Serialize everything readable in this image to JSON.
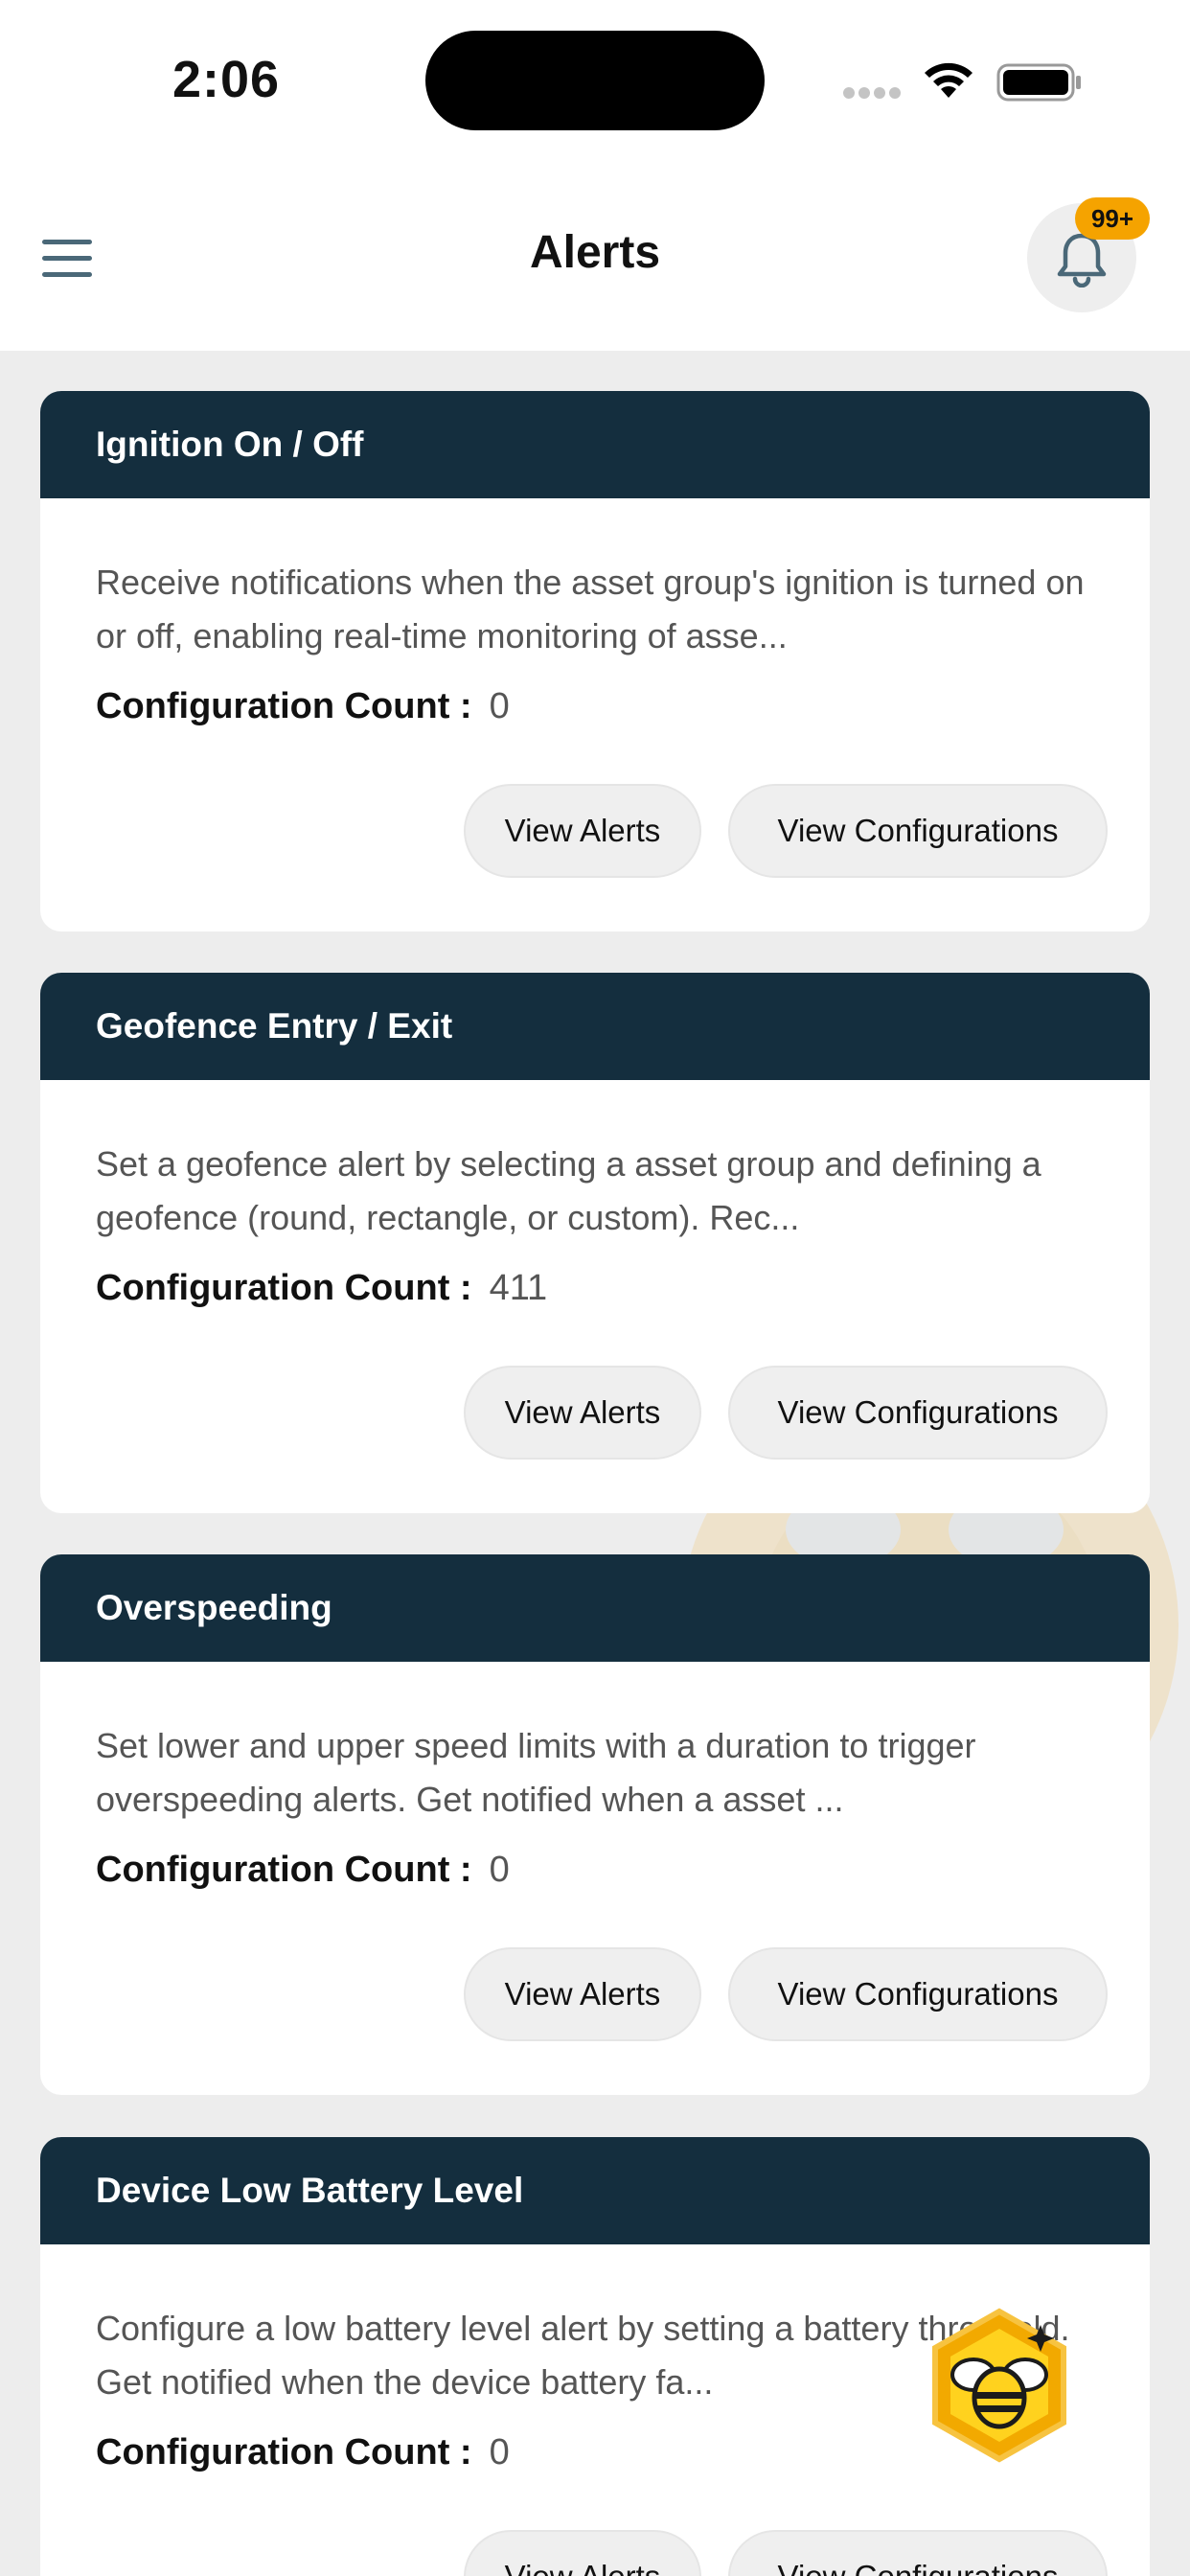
{
  "status_bar": {
    "time": "2:06"
  },
  "header": {
    "title": "Alerts",
    "notification_badge": "99+"
  },
  "cards": [
    {
      "title": "Ignition On / Off",
      "description": "Receive notifications when the asset group's ignition is turned on or off, enabling real-time monitoring of asse...",
      "count_label": "Configuration Count :",
      "count_value": "0",
      "view_alerts": "View Alerts",
      "view_configurations": "View Configurations"
    },
    {
      "title": "Geofence Entry / Exit",
      "description": "Set a geofence alert by selecting a asset group and defining a geofence (round, rectangle, or custom). Rec...",
      "count_label": "Configuration Count :",
      "count_value": "411",
      "view_alerts": "View Alerts",
      "view_configurations": "View Configurations"
    },
    {
      "title": "Overspeeding",
      "description": "Set lower and upper speed limits with a duration to trigger overspeeding alerts. Get notified when a asset ...",
      "count_label": "Configuration Count :",
      "count_value": "0",
      "view_alerts": "View Alerts",
      "view_configurations": "View Configurations"
    },
    {
      "title": "Device Low Battery Level",
      "description": "Configure a low battery level alert by setting a battery threshold. Get notified when the device battery fa...",
      "count_label": "Configuration Count :",
      "count_value": "0",
      "view_alerts": "View Alerts",
      "view_configurations": "View Configurations"
    }
  ],
  "icons": {
    "menu": "hamburger-menu-icon",
    "bell": "bell-icon",
    "assistant": "bee-assistant-icon"
  },
  "colors": {
    "card_header": "#142e3e",
    "badge": "#f5a300",
    "background": "#ededed"
  }
}
